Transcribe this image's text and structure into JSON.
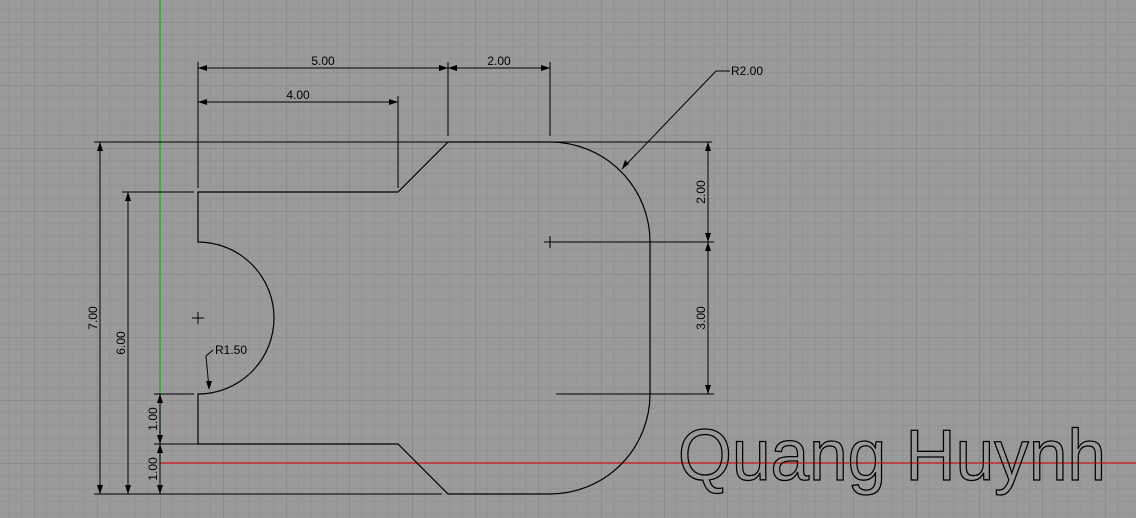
{
  "colors": {
    "background": "#9a9a9a",
    "grid_minor": "#8d8d8d",
    "grid_major": "#808080",
    "axis_x": "#d01010",
    "axis_y": "#10b010",
    "geometry": "#000000"
  },
  "dimensions": {
    "top_5": "5.00",
    "top_2": "2.00",
    "top_4": "4.00",
    "radius_big": "R2.00",
    "radius_small": "R1.50",
    "left_7": "7.00",
    "left_6": "6.00",
    "left_1_upper": "1.00",
    "left_1_lower": "1.00",
    "right_2": "2.00",
    "right_3": "3.00"
  },
  "signature": "Quang Huynh"
}
